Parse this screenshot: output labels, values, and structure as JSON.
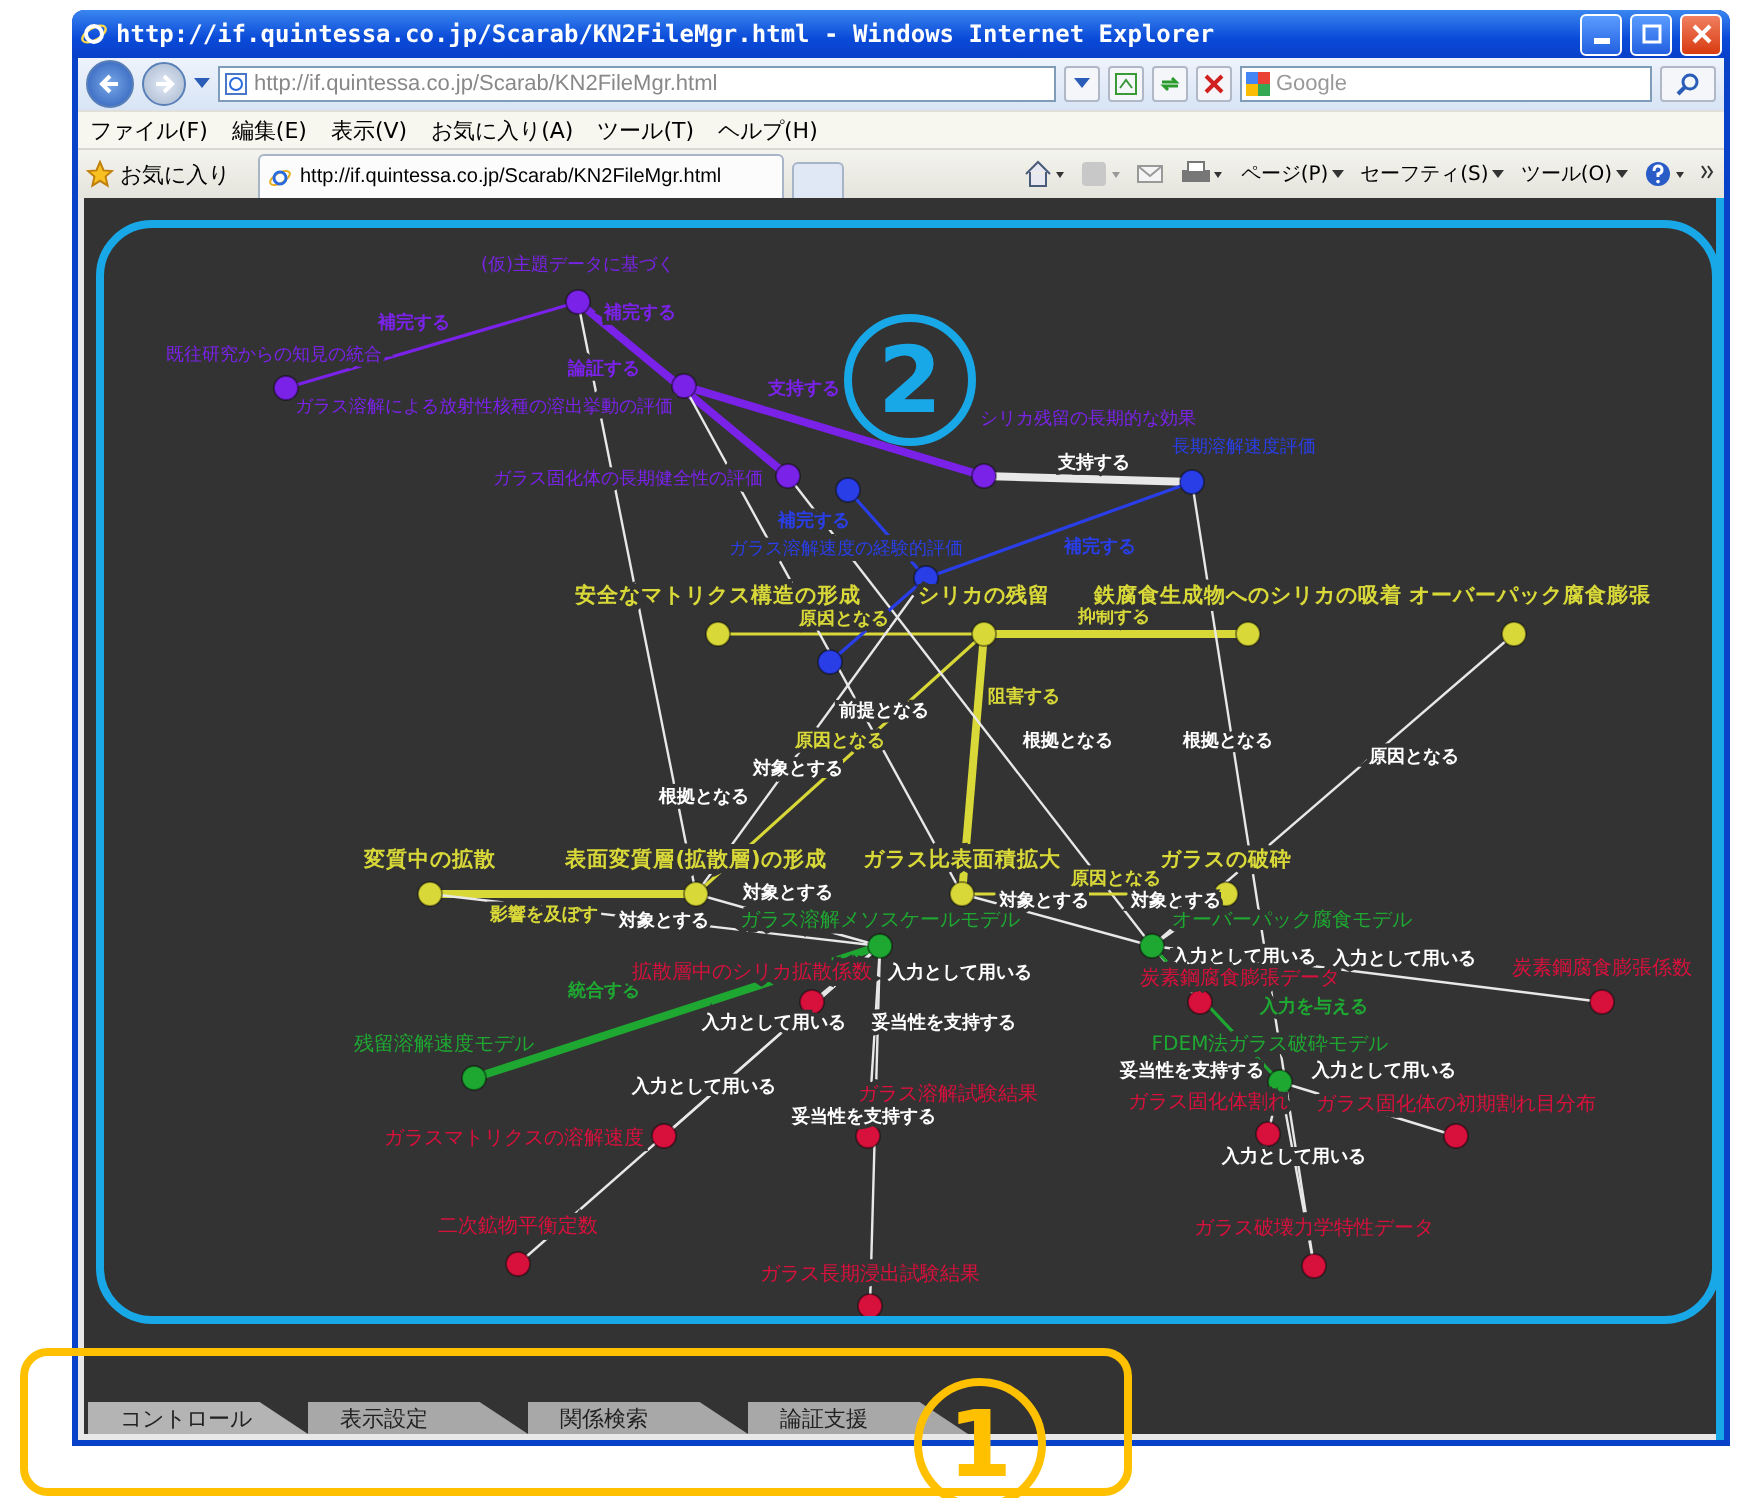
{
  "window": {
    "title": "http://if.quintessa.co.jp/Scarab/KN2FileMgr.html - Windows Internet Explorer"
  },
  "address_bar": {
    "url": "http://if.quintessa.co.jp/Scarab/KN2FileMgr.html",
    "search": {
      "placeholder": "Google"
    }
  },
  "menu": [
    "ファイル(F)",
    "編集(E)",
    "表示(V)",
    "お気に入り(A)",
    "ツール(T)",
    "ヘルプ(H)"
  ],
  "favorites_bar": {
    "favorites": "お気に入り",
    "tabs": [
      {
        "label": "http://if.quintessa.co.jp/Scarab/KN2FileMgr.html",
        "selected": true
      }
    ],
    "tools": [
      "ページ(P)",
      "セーフティ(S)",
      "ツール(O)"
    ]
  },
  "graph": {
    "nodes": [
      {
        "label": "(仮)主題データに基づく",
        "color": "#7a22e8"
      },
      {
        "label": "既往研究からの知見の統合",
        "color": "#7a22e8"
      },
      {
        "label": "ガラス溶解による放射性核種の溶出挙動の評価",
        "color": "#7a22e8"
      },
      {
        "label": "ガラス固化体の長期健全性の評価",
        "color": "#7a22e8"
      },
      {
        "label": "シリカ残留の長期的な効果",
        "color": "#7a22e8"
      },
      {
        "label": "長期溶解速度評価",
        "color": "#2a3ee8"
      },
      {
        "color": "#2a3ee8"
      },
      {
        "label": "ガラス溶解速度の経験的評価",
        "color": "#2a3ee8"
      },
      {
        "color": "#2a3ee8"
      },
      {
        "label": "安全なマトリクス構造の形成",
        "color": "#d8d838"
      },
      {
        "label": "シリカの残留",
        "color": "#d8d838"
      },
      {
        "label": "鉄腐食生成物へのシリカの吸着",
        "color": "#d8d838"
      },
      {
        "label": "オーバーパック腐食膨張",
        "color": "#d8d838"
      },
      {
        "label": "変質中の拡散",
        "color": "#d8d838"
      },
      {
        "label": "表面変質層(拡散層)の形成",
        "color": "#d8d838"
      },
      {
        "label": "ガラス比表面積拡大",
        "color": "#d8d838"
      },
      {
        "label": "ガラスの破砕",
        "color": "#d8d838"
      },
      {
        "label": "ガラス溶解メソスケールモデル",
        "color": "#1ea832"
      },
      {
        "label": "オーバーパック腐食モデル",
        "color": "#1ea832"
      },
      {
        "label": "残留溶解速度モデル",
        "color": "#1ea832"
      },
      {
        "label": "FDEM法ガラス破砕モデル",
        "color": "#1ea832"
      },
      {
        "label": "拡散層中のシリカ拡散係数",
        "color": "#d8103c"
      },
      {
        "label": "炭素鋼腐食膨張データ",
        "color": "#d8103c"
      },
      {
        "label": "炭素鋼腐食膨張係数",
        "color": "#d8103c"
      },
      {
        "label": "ガラスマトリクスの溶解速度",
        "color": "#d8103c"
      },
      {
        "label": "ガラス溶解試験結果",
        "color": "#d8103c"
      },
      {
        "label": "ガラス固化体割れ",
        "color": "#d8103c"
      },
      {
        "label": "ガラス固化体の初期割れ目分布",
        "color": "#d8103c"
      },
      {
        "label": "二次鉱物平衡定数",
        "color": "#d8103c"
      },
      {
        "label": "ガラス長期浸出試験結果",
        "color": "#d8103c"
      },
      {
        "label": "ガラス破壊力学特性データ",
        "color": "#d8103c"
      }
    ],
    "edges": [
      {
        "label": "補完する"
      },
      {
        "label": "補完する"
      },
      {
        "label": "論証する"
      },
      {
        "label": "支持する"
      },
      {
        "label": "支持する"
      },
      {
        "label": "補完する"
      },
      {
        "label": "補完する"
      },
      {
        "label": "原因となる"
      },
      {
        "label": "抑制する"
      },
      {
        "label": "前提となる"
      },
      {
        "label": "阻害する"
      },
      {
        "label": "原因となる"
      },
      {
        "label": "根拠となる"
      },
      {
        "label": "根拠となる"
      },
      {
        "label": "原因となる"
      },
      {
        "label": "対象とする"
      },
      {
        "label": "根拠となる"
      },
      {
        "label": "影響を及ぼす"
      },
      {
        "label": "原因となる"
      },
      {
        "label": "対象とする"
      },
      {
        "label": "対象とする"
      },
      {
        "label": "対象とする"
      },
      {
        "label": "対象とする"
      },
      {
        "label": "入力として用いる"
      },
      {
        "label": "入力として用いる"
      },
      {
        "label": "入力として用いる"
      },
      {
        "label": "統合する"
      },
      {
        "label": "入力として用いる"
      },
      {
        "label": "妥当性を支持する"
      },
      {
        "label": "入力を与える"
      },
      {
        "label": "入力として用いる"
      },
      {
        "label": "妥当性を支持する"
      },
      {
        "label": "入力として用いる"
      },
      {
        "label": "妥当性を支持する"
      },
      {
        "label": "入力として用いる"
      }
    ]
  },
  "bottom_tabs": [
    {
      "label": "コントロール",
      "selected": true
    },
    {
      "label": "表示設定",
      "selected": false
    },
    {
      "label": "関係検索",
      "selected": false
    },
    {
      "label": "論証支援",
      "selected": false
    }
  ],
  "annotations": [
    {
      "number": "2",
      "color": "#18a8e8"
    },
    {
      "number": "1",
      "color": "#ffc000"
    }
  ]
}
